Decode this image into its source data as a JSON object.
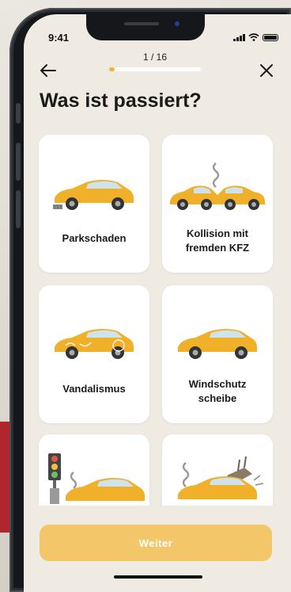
{
  "status_bar": {
    "time": "9:41"
  },
  "header": {
    "step_text": "1 / 16",
    "progress": 0.06
  },
  "title": "Was ist passiert?",
  "options": [
    {
      "id": "parkschaden",
      "label": "Parkschaden"
    },
    {
      "id": "kollision",
      "label_line1": "Kollision mit",
      "label_line2": "fremden KFZ"
    },
    {
      "id": "vandalismus",
      "label": "Vandalismus"
    },
    {
      "id": "windschutzscheibe",
      "label_line1": "Windschutz",
      "label_line2": "scheibe"
    },
    {
      "id": "ampel",
      "label": ""
    },
    {
      "id": "sturm",
      "label": ""
    }
  ],
  "footer": {
    "continue_label": "Weiter"
  },
  "colors": {
    "accent": "#f1b13c",
    "button": "#f3c769",
    "background": "#efebe3",
    "car": "#f0b02a"
  },
  "icons": [
    "back-arrow-icon",
    "close-icon",
    "signal-icon",
    "wifi-icon",
    "battery-icon"
  ]
}
